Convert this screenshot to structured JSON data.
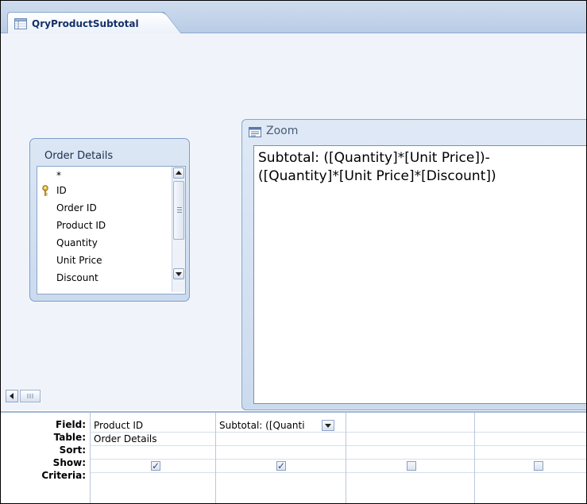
{
  "document_tab": {
    "title": "QryProductSubtotal",
    "icon": "query-icon"
  },
  "table_box": {
    "title": "Order Details",
    "fields": [
      "*",
      "ID",
      "Order ID",
      "Product ID",
      "Quantity",
      "Unit Price",
      "Discount"
    ],
    "primary_key": "ID"
  },
  "zoom": {
    "title": "Zoom",
    "expression": "Subtotal: ([Quantity]*[Unit Price])-\n([Quantity]*[Unit Price]*[Discount])"
  },
  "grid": {
    "row_labels": {
      "field": "Field:",
      "table": "Table:",
      "sort": "Sort:",
      "show": "Show:",
      "criteria": "Criteria:"
    },
    "columns": [
      {
        "field": "Product ID",
        "table": "Order Details",
        "sort": "",
        "show": true
      },
      {
        "field": "Subtotal: ([Quanti",
        "table": "",
        "sort": "",
        "show": true
      },
      {
        "field": "",
        "table": "",
        "sort": "",
        "show": false
      },
      {
        "field": "",
        "table": "",
        "sort": "",
        "show": false
      }
    ]
  },
  "colors": {
    "tab_text": "#15306a",
    "panel_bg": "#cbdaee",
    "check": "#2d4a8a"
  }
}
